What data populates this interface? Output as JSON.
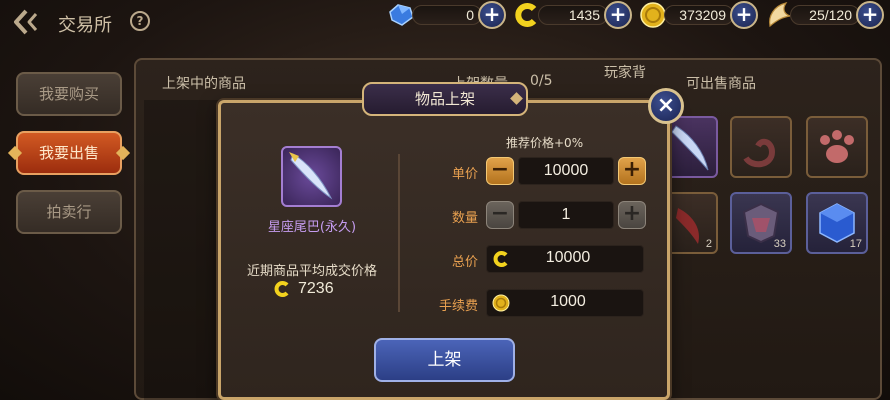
{
  "header": {
    "title": "交易所",
    "help": "?"
  },
  "resources": [
    {
      "icon": "blue-gem-icon",
      "value": "0"
    },
    {
      "icon": "c-coin-icon",
      "value": "1435"
    },
    {
      "icon": "gold-coin-icon",
      "value": "373209"
    },
    {
      "icon": "stamina-wing-icon",
      "value": "25/120"
    }
  ],
  "plus_symbol": "+",
  "sidebar": {
    "items": [
      {
        "label": "我要购买"
      },
      {
        "label": "我要出售"
      },
      {
        "label": "拍卖行"
      }
    ]
  },
  "panel": {
    "left_header": "上架中的商品",
    "partial_header": "上架数量",
    "slot_count": "0/5",
    "player_bag": "玩家背",
    "right_header": "可出售商品",
    "inventory": [
      {
        "icon": "tail-feather-icon",
        "count": ""
      },
      {
        "icon": "horn-icon",
        "count": ""
      },
      {
        "icon": "paw-icon",
        "count": ""
      },
      {
        "icon": "claw-icon",
        "count": "2"
      },
      {
        "icon": "armor-icon",
        "count": "33"
      },
      {
        "icon": "blue-cube-icon",
        "count": "17"
      }
    ]
  },
  "dialog": {
    "title": "物品上架",
    "close": "×",
    "item_name": "星座尾巴(永久)",
    "avg_label": "近期商品平均成交价格",
    "avg_price": "7236",
    "recommend": "推荐价格+0%",
    "unit_price_label": "单价",
    "unit_price": "10000",
    "quantity_label": "数量",
    "quantity": "1",
    "total_label": "总价",
    "total": "10000",
    "fee_label": "手续费",
    "fee": "1000",
    "minus": "−",
    "plus": "+",
    "submit": "上架"
  },
  "colors": {
    "accent_orange": "#e8a050",
    "active_tab": "#c4481b",
    "submit_blue": "#3b52a0",
    "item_purple": "#c59cf0"
  }
}
